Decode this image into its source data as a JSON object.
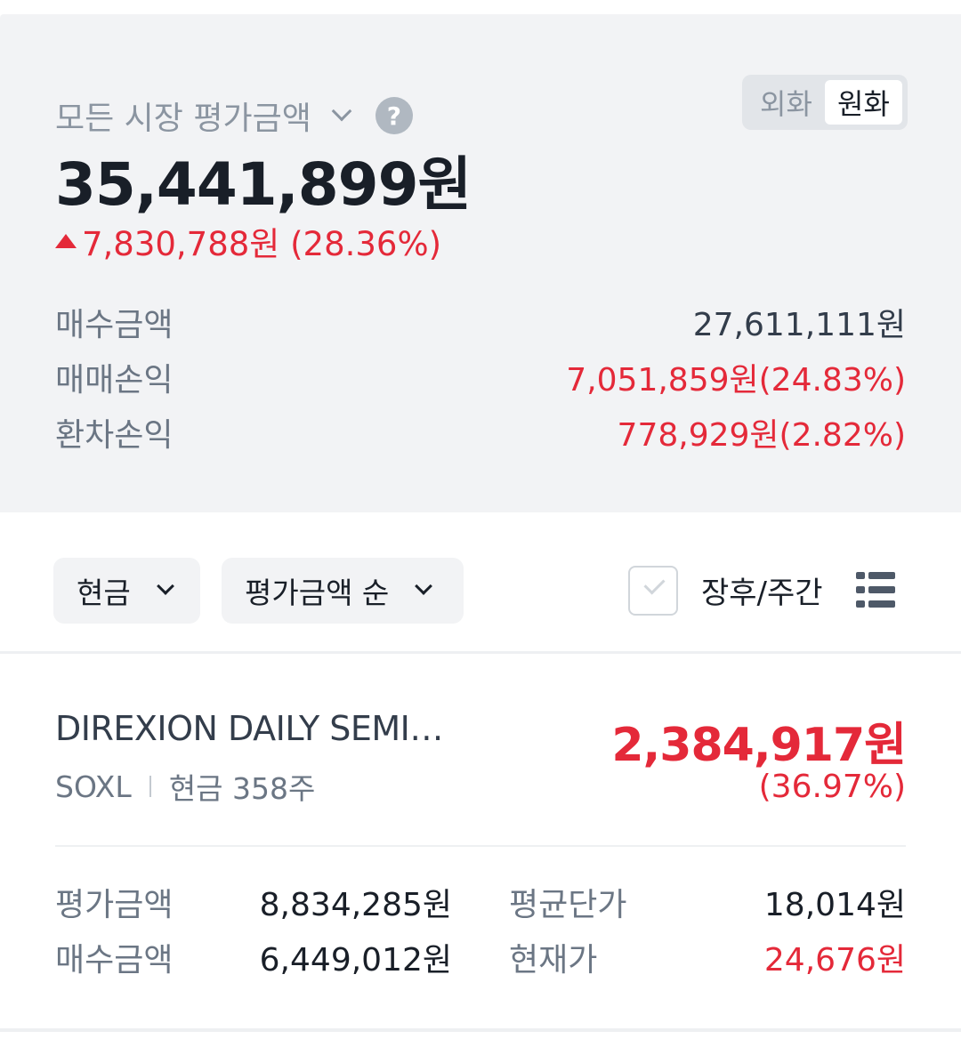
{
  "summary": {
    "market_label": "모든 시장 평가금액",
    "help_icon": "?",
    "fx_options": [
      "외화",
      "원화"
    ],
    "total_value": "35,441,899원",
    "change_text": "7,830,788원 (28.36%)",
    "rows": [
      {
        "label": "매수금액",
        "value": "27,611,111원"
      },
      {
        "label": "매매손익",
        "value": "7,051,859원(24.83%)"
      },
      {
        "label": "환차손익",
        "value": "778,929원(2.82%)"
      }
    ]
  },
  "filters": {
    "account_type": "현금",
    "sort": "평가금액 순",
    "after_hours": "장후/주간"
  },
  "holding": {
    "name": "DIREXION DAILY SEMI…",
    "ticker": "SOXL",
    "qty": "현금 358주",
    "value": "2,384,917원",
    "rate": "(36.97%)",
    "details": {
      "eval_label": "평가금액",
      "eval_value": "8,834,285원",
      "buy_label": "매수금액",
      "buy_value": "6,449,012원",
      "avg_label": "평균단가",
      "avg_value": "18,014원",
      "price_label": "현재가",
      "price_value": "24,676원"
    }
  },
  "colors": {
    "up_red": "#e42939",
    "summary_bg": "#f2f3f5"
  },
  "icons": [
    "chevron-down-icon",
    "help-icon",
    "check-icon",
    "list-view-icon",
    "up-triangle-icon"
  ]
}
